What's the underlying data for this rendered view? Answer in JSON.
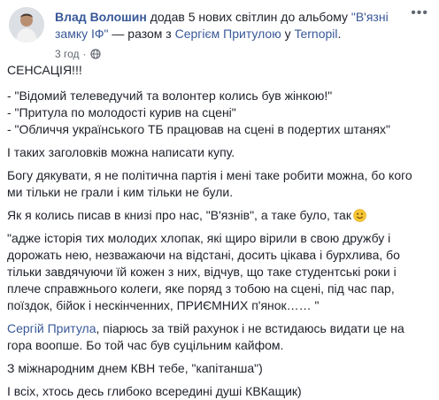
{
  "header": {
    "author": "Влад Волошин",
    "action_text": " додав 5 нових світлин до альбому ",
    "album": "\"В'язні замку ІФ\"",
    "with_text": " — разом з ",
    "tagged": "Сергієм Притулою",
    "in_text": " у ",
    "place": "Ternopil",
    "end": ".",
    "time": "3 год"
  },
  "icons": {
    "audience": "globe-icon",
    "menu": "more-icon",
    "emoji": "smile-emoji-icon"
  },
  "post": {
    "title": "СЕНСАЦІЯ!!!",
    "headline1": "- \"Відомий телеведучий та волонтер колись був жінкою!\"",
    "headline2": "- \"Притула по молодості курив на сцені\"",
    "headline3": "- \"Обличчя українського ТБ працював на сцені в подертих штанях\"",
    "para1": "І таких заголовків можна написати купу.",
    "para2": "Богу дякувати, я не політична партія і мені таке робити можна, бо кого ми тільки не грали і ким тільки не були.",
    "para3": "Як я колись писав в книзі про нас, \"В'язнів\", а таке було, так",
    "quote": "\"адже історія тих молодих хлопак, які щиро вірили в свою дружбу і дорожать нею, незважаючи на відстані, досить цікава і бурхлива, бо тільки завдячуючи їй кожен з них, відчув, що таке студентські роки і плече справжнього колеги, яке поряд з тобою на сцені, під час пар, поїздок, бійок і нескінченних, ПРИЄМНИХ п'янок…… \"",
    "mention": "Сергій Притула",
    "para4_rest": ", піарюсь за твій рахунок і не встидаюсь видати це на гора воопше. Бо той час був суцільним кайфом.",
    "para5": "З міжнародним днем КВН тебе, \"капітанша\")",
    "para6": "І всіх, хтось десь глибоко всередині душі КВКащик)"
  }
}
